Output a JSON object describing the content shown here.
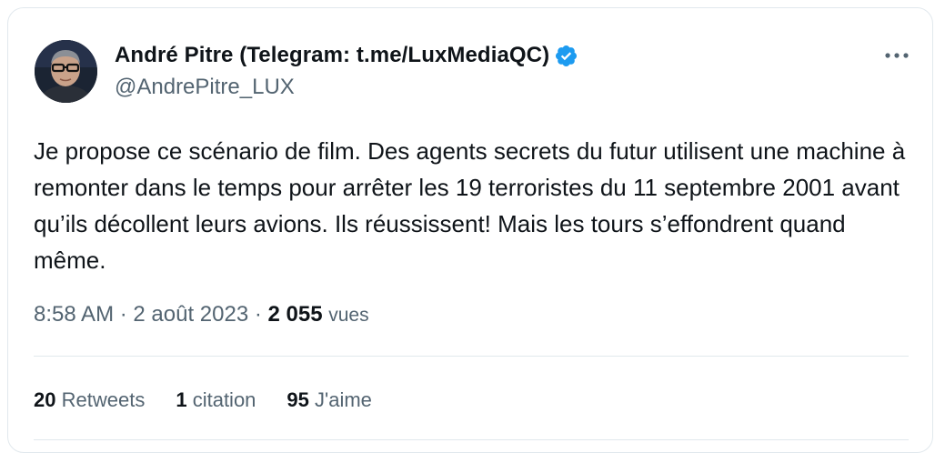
{
  "author": {
    "name": "André Pitre (Telegram: t.me/LuxMediaQC)",
    "handle": "@AndrePitre_LUX",
    "verified": true,
    "verified_color": "#1d9bf0"
  },
  "tweet": {
    "text": "Je propose ce scénario de film. Des agents secrets du futur utilisent une machine à remonter dans le temps pour arrêter les 19 terroristes du 11 septembre 2001 avant qu’ils décollent leurs avions. Ils réussissent!  Mais les tours s’effondrent quand même.",
    "time": "8:58 AM",
    "separator": " · ",
    "date": "2 août 2023",
    "views_count": "2 055",
    "views_label": "vues"
  },
  "stats": {
    "retweets_count": "20",
    "retweets_label": "Retweets",
    "quotes_count": "1",
    "quotes_label": "citation",
    "likes_count": "95",
    "likes_label": "J'aime"
  },
  "icons": {
    "avatar": "profile-photo",
    "verified": "verified-badge-icon",
    "more": "more-options-icon"
  }
}
